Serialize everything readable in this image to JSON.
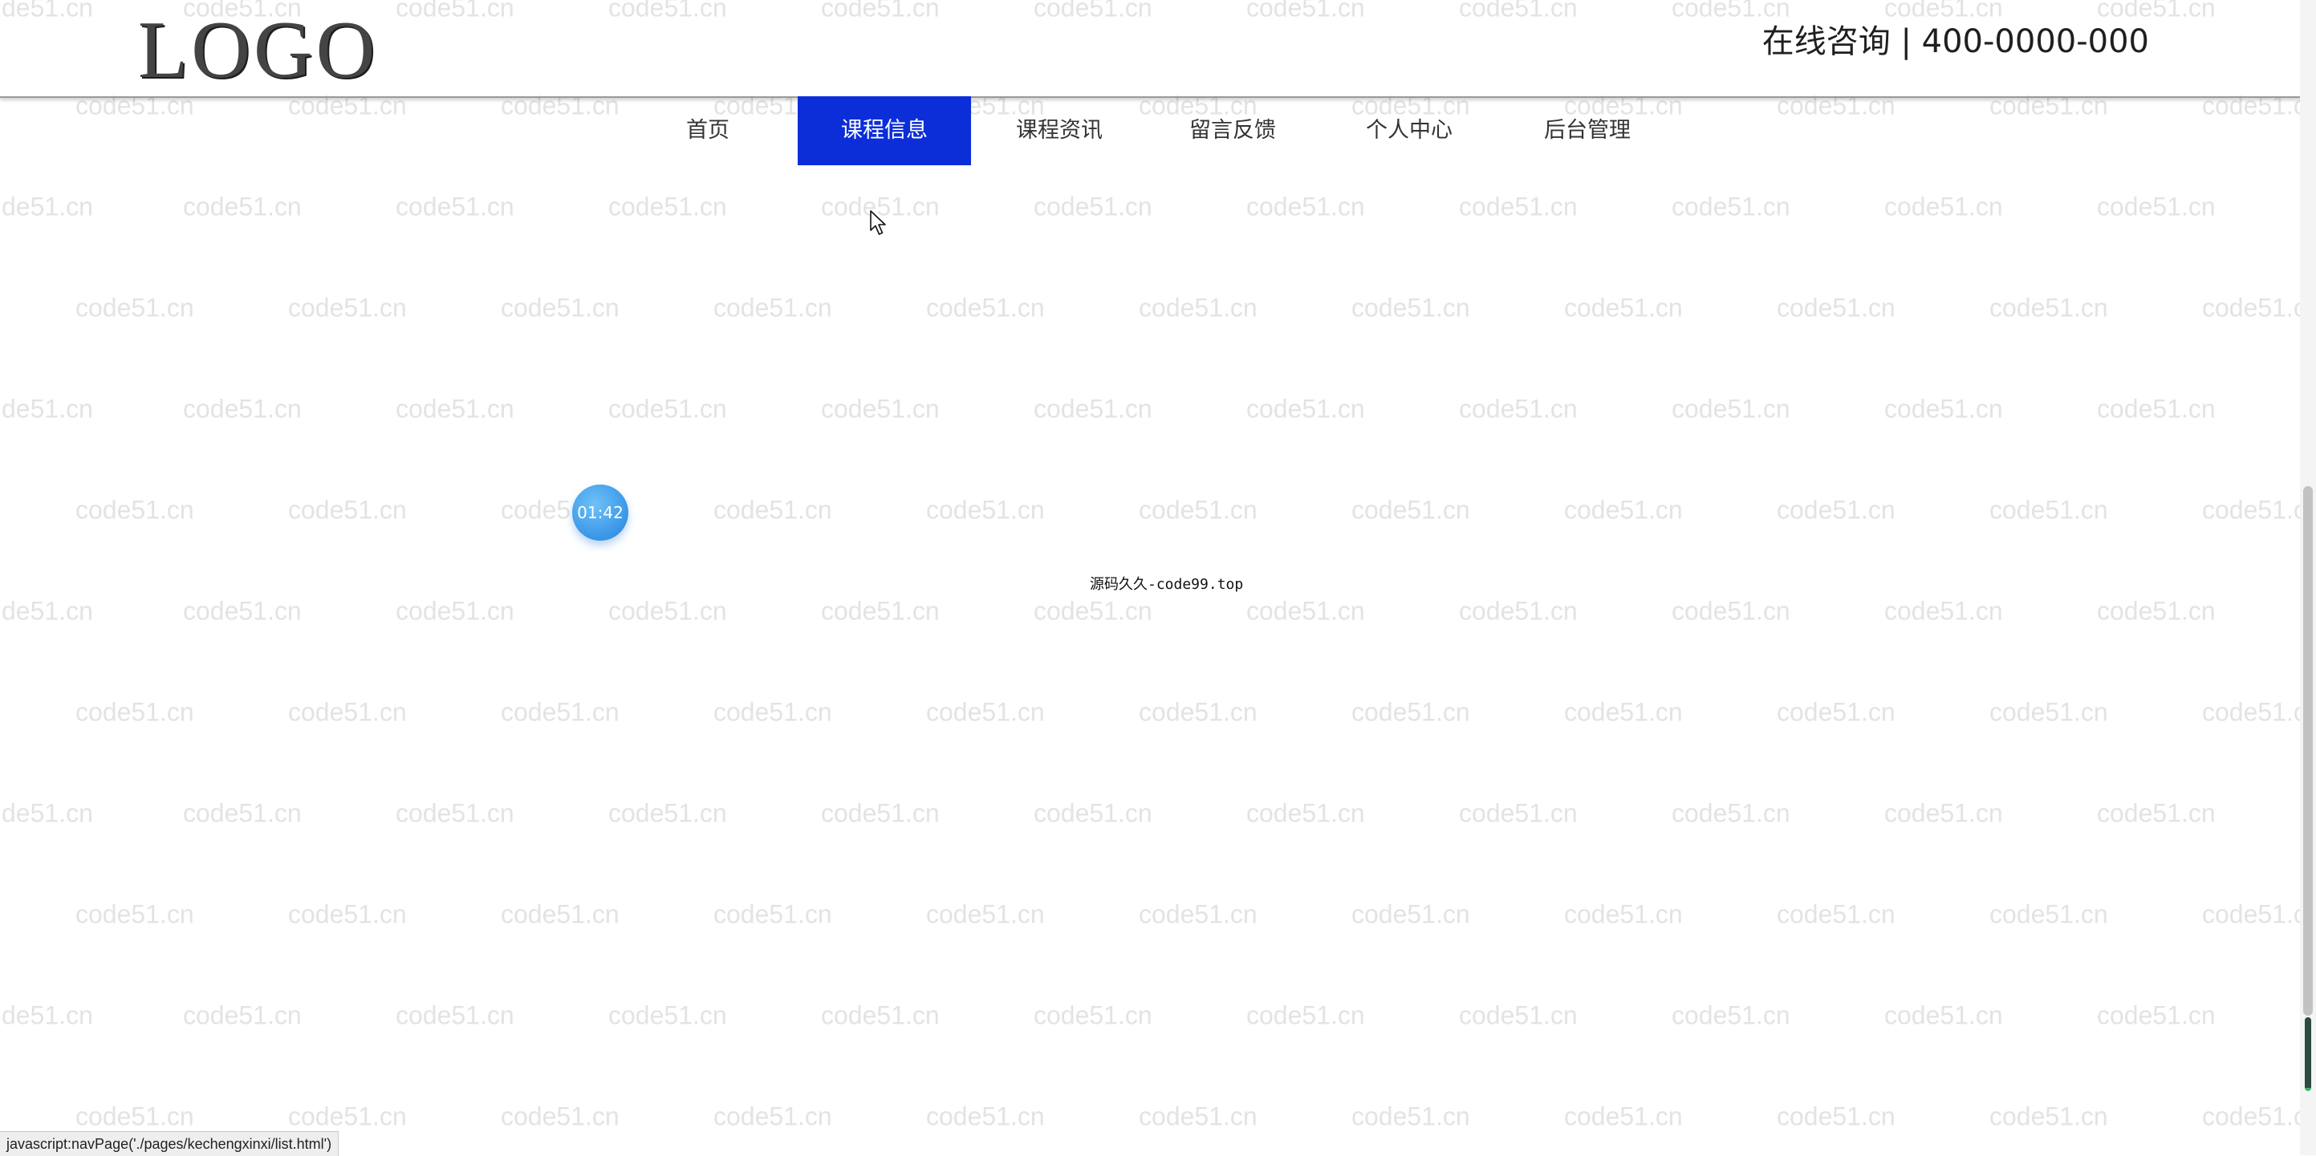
{
  "watermark": {
    "text": "code51.cn",
    "partial_text": "de51.cn"
  },
  "header": {
    "logo": "LOGO",
    "phone": "在线咨询 | 400-0000-000"
  },
  "nav": {
    "items": [
      {
        "label": "首页",
        "active": false
      },
      {
        "label": "课程信息",
        "active": true
      },
      {
        "label": "课程资讯",
        "active": false
      },
      {
        "label": "留言反馈",
        "active": false
      },
      {
        "label": "个人中心",
        "active": false
      },
      {
        "label": "后台管理",
        "active": false
      }
    ]
  },
  "timer": {
    "label": "01:42"
  },
  "footer": {
    "source_text": "源码久久-code99.top"
  },
  "status_bar": {
    "link": "javascript:navPage('./pages/kechengxinxi/list.html')"
  },
  "colors": {
    "nav_active_bg": "#0c2ed8",
    "watermark": "#e3e3e3",
    "timer_bubble": "#3d98e9"
  },
  "icons": {
    "cursor": "mouse-pointer-icon"
  }
}
